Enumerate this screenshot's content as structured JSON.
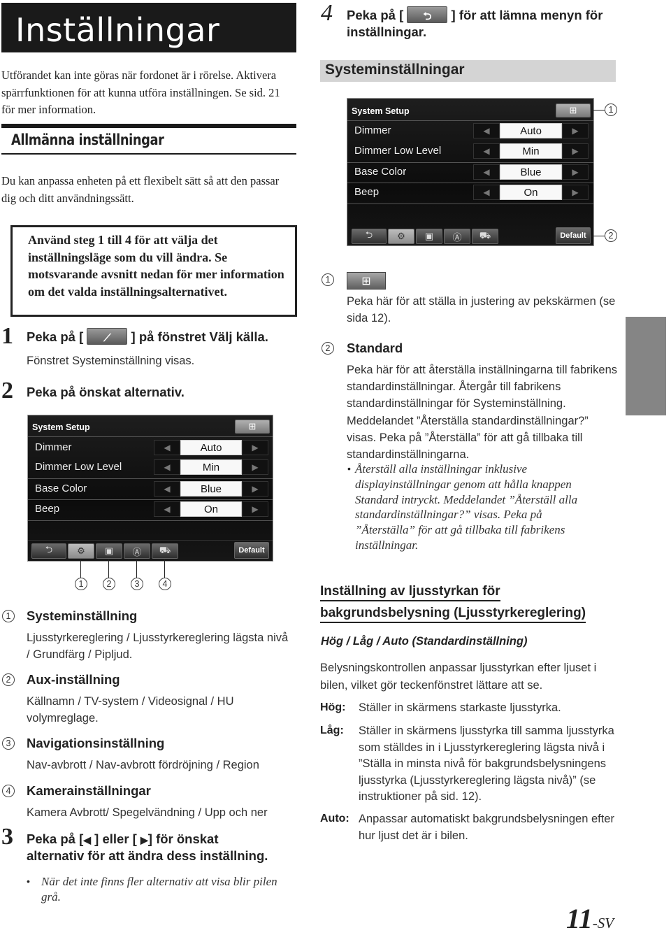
{
  "page_title": "Inställningar",
  "intro_text": "Utförandet kan inte göras när fordonet är i rörelse. Aktivera spärrfunktionen för att kunna utföra inställningen. Se sid. 21 för mer information.",
  "section_title": "Allmänna inställningar",
  "section_intro": "Du kan anpassa enheten på ett flexibelt sätt så att den passar dig och ditt användningssätt.",
  "info_box": "Använd steg 1 till 4 för att välja det inställningsläge som du vill ändra. Se motsvarande avsnitt nedan för mer information om det valda inställningsalternativet.",
  "steps": [
    {
      "num": "1",
      "text_before": "Peka på [",
      "icon": "wrench-icon",
      "text_after": "] på fönstret Välj källa.",
      "note": "Fönstret Systeminställning visas."
    },
    {
      "num": "2",
      "text": "Peka på önskat alternativ."
    },
    {
      "num": "3",
      "text_line1": "Peka på [",
      "left_arrow": "◀",
      "mid": " ] eller [ ",
      "right_arrow": "▶",
      "text_line1_end": "] för önskat",
      "text_line2": "alternativ för att ändra dess inställning.",
      "note": "När det inte finns fler alternativ att visa blir pilen grå."
    },
    {
      "num": "4",
      "text_before": "Peka på [",
      "icon": "back-arrow-icon",
      "text_after": "] för att lämna menyn för",
      "text_line2": "inställningar."
    }
  ],
  "screen": {
    "title": "System Setup",
    "rows": [
      {
        "label": "Dimmer",
        "value": "Auto"
      },
      {
        "label": "Dimmer Low Level",
        "value": "Min"
      },
      {
        "label": "Base Color",
        "value": "Blue"
      },
      {
        "label": "Beep",
        "value": "On"
      }
    ],
    "left_arrow": "◀",
    "right_arrow": "▶",
    "default_label": "Default",
    "back_glyph": "⮌",
    "tabs": [
      "system-settings",
      "aux-settings",
      "navigation-settings",
      "camera-settings"
    ]
  },
  "tab_callouts": [
    "1",
    "2",
    "3",
    "4"
  ],
  "tab_items": [
    {
      "num": "1",
      "title": "Systeminställning",
      "desc": "Ljusstyrkereglering / Ljusstyrkereglering lägsta nivå / Grundfärg / Pipljud."
    },
    {
      "num": "2",
      "title": "Aux-inställning",
      "desc": "Källnamn / TV-system / Videosignal / HU volymreglage."
    },
    {
      "num": "3",
      "title": "Navigationsinställning",
      "desc": "Nav-avbrott / Nav-avbrott fördröjning / Region"
    },
    {
      "num": "4",
      "title": "Kamerainställningar",
      "desc": "Kamera Avbrott/ Spegelvändning / Upp och ner"
    }
  ],
  "sys_heading": "Systeminställningar",
  "callouts": {
    "c1": "1",
    "c2": "2"
  },
  "explain": {
    "c1_text": "Peka här för att ställa in justering av pekskärmen (se sida 12).",
    "c2_title": "Standard",
    "c2_text": "Peka här för att återställa inställningarna till fabrikens standardinställningar. Återgår till fabrikens standardinställningar för Systeminställning. Meddelandet ”Återställa standardinställningar?” visas. Peka på ”Återställa” för att gå tillbaka till standardinställningarna.",
    "c2_note": "Återställ alla inställningar inklusive displayinställningar genom att hålla knappen Standard intryckt. Meddelandet ”Återställ alla standardinställningar?” visas. Peka på ”Återställa” för att gå tillbaka till fabrikens inställningar."
  },
  "dimmer": {
    "heading_line1": "Inställning av ljusstyrkan för",
    "heading_line2": "bakgrundsbelysning (Ljusstyrkereglering)",
    "options": "Hög / Låg / Auto (Standardinställning)",
    "desc": "Belysningskontrollen anpassar ljusstyrkan efter ljuset i bilen, vilket gör teckenfönstret lättare att se.",
    "defs": [
      {
        "term": "Hög:",
        "text": "Ställer in skärmens starkaste ljusstyrka."
      },
      {
        "term": "Låg:",
        "text": "Ställer in skärmens ljusstyrka till samma ljusstyrka som ställdes in i Ljusstyrkereglering lägsta nivå i ”Ställa in minsta nivå för bakgrundsbelysningens ljusstyrka (Ljusstyrkereglering lägsta nivå)” (se instruktioner på sid. 12)."
      },
      {
        "term": "Auto:",
        "text": "Anpassar automatiskt bakgrundsbelysningen efter hur ljust det är i bilen."
      }
    ]
  },
  "page_number": "11",
  "page_suffix": "-SV"
}
